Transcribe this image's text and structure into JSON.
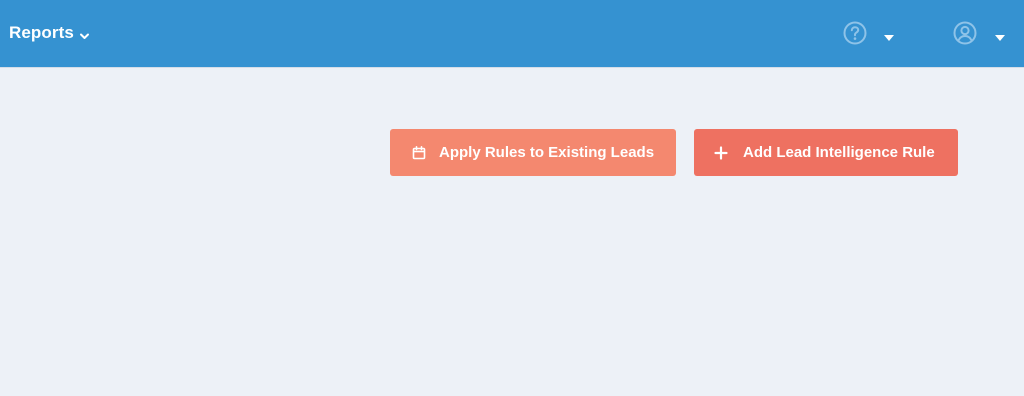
{
  "header": {
    "reports_label": "Reports",
    "reports_icon": "chevron-down-icon",
    "help_icon": "question-circle-icon",
    "user_icon": "user-circle-icon",
    "caret_icon": "caret-down-icon",
    "background_color": "#3592d1"
  },
  "actions": {
    "apply_rules_label": "Apply Rules to Existing Leads",
    "apply_rules_icon": "calendar-icon",
    "apply_rules_color": "#f4886f",
    "add_rule_label": "Add Lead Intelligence Rule",
    "add_rule_icon": "plus-icon",
    "add_rule_color": "#ee7161"
  },
  "page": {
    "background_color": "#edf1f7"
  }
}
